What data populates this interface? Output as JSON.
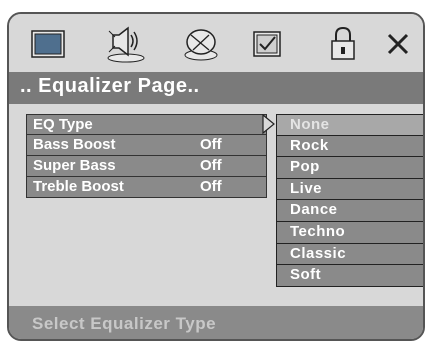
{
  "title": ".. Equalizer  Page..",
  "toolbar": {
    "icons": [
      "tv-icon",
      "speaker-icon",
      "disc-icon",
      "checkbox-icon",
      "lock-icon",
      "close-icon"
    ]
  },
  "menu": {
    "items": [
      {
        "label": "EQ Type",
        "value": ""
      },
      {
        "label": "Bass Boost",
        "value": "Off"
      },
      {
        "label": "Super Bass",
        "value": "Off"
      },
      {
        "label": "Treble Boost",
        "value": "Off"
      }
    ]
  },
  "options": {
    "selected": "None",
    "items": [
      "None",
      "Rock",
      "Pop",
      "Live",
      "Dance",
      "Techno",
      "Classic",
      "Soft"
    ]
  },
  "status": "Select Equalizer Type"
}
